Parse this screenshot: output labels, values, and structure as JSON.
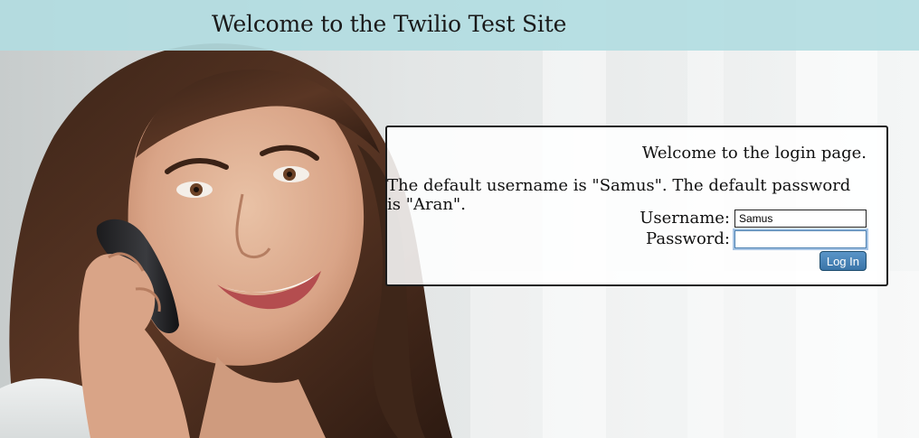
{
  "header": {
    "title": "Welcome to the Twilio Test Site"
  },
  "login": {
    "welcome_text": "Welcome to the login page.",
    "default_credentials_text": "The default username is \"Samus\". The default password is \"Aran\".",
    "username_label": "Username:",
    "username_value": "Samus",
    "password_label": "Password:",
    "password_value": "",
    "login_button_label": "Log In"
  },
  "hero_image": {
    "subject": "woman-on-phone-photo"
  },
  "colors": {
    "header_bg": "#b2dce1",
    "button_bg": "#3b75a8",
    "panel_border": "#1b1b1b"
  }
}
